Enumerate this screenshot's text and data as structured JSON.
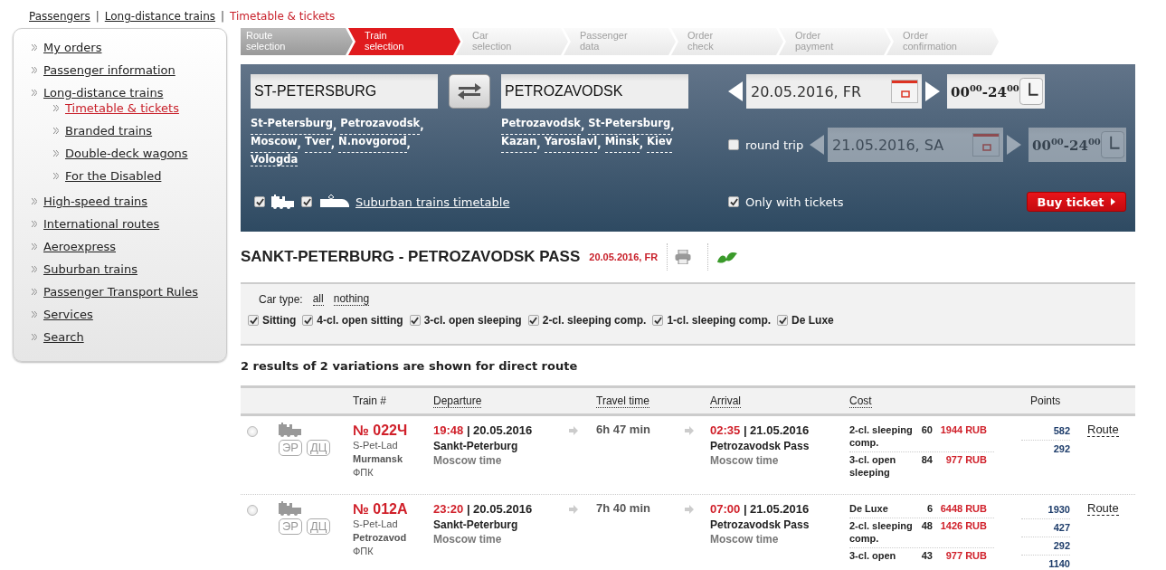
{
  "breadcrumb_separator": "|",
  "suggestion_separator": ",",
  "breadcrumbs": [
    {
      "label": "Passengers",
      "selected": false
    },
    {
      "label": "Long-distance trains",
      "selected": false
    },
    {
      "label": "Timetable & tickets",
      "selected": true
    }
  ],
  "sidebar": {
    "items": [
      {
        "label": "My orders",
        "selected": false
      },
      {
        "label": "Passenger information",
        "selected": false
      },
      {
        "label": "Long-distance trains",
        "selected": false,
        "children": [
          {
            "label": "Timetable & tickets",
            "selected": true
          },
          {
            "label": "Branded trains",
            "selected": false
          },
          {
            "label": "Double-deck wagons",
            "selected": false
          },
          {
            "label": "For the Disabled",
            "selected": false
          }
        ]
      },
      {
        "label": "High-speed trains",
        "selected": false
      },
      {
        "label": "International routes",
        "selected": false
      },
      {
        "label": "Aeroexpress",
        "selected": false
      },
      {
        "label": "Suburban trains",
        "selected": false
      },
      {
        "label": "Passenger Transport Rules",
        "selected": false
      },
      {
        "label": "Services",
        "selected": false
      },
      {
        "label": "Search",
        "selected": false
      }
    ]
  },
  "steps": [
    {
      "label": "Route selection",
      "selected": false,
      "completed": true
    },
    {
      "label": "Train selection",
      "selected": true,
      "completed": false
    },
    {
      "label": "Car selection",
      "selected": false,
      "completed": false
    },
    {
      "label": "Passenger data",
      "selected": false,
      "completed": false
    },
    {
      "label": "Order check",
      "selected": false,
      "completed": false
    },
    {
      "label": "Order payment",
      "selected": false,
      "completed": false
    },
    {
      "label": "Order confirmation",
      "selected": false,
      "completed": false
    }
  ],
  "search": {
    "from": {
      "value": "ST-PETERSBURG",
      "suggestions": [
        "St-Petersburg",
        "Petrozavodsk",
        "Moscow",
        "Tver",
        "N.novgorod",
        "Vologda"
      ]
    },
    "to": {
      "value": "PETROZAVODSK",
      "suggestions": [
        "Petrozavodsk",
        "St-Petersburg",
        "Kazan",
        "Yaroslavl",
        "Minsk",
        "Kiev"
      ]
    },
    "depart": {
      "date": "20.05.2016, FR",
      "time": "00$^{00}$-24$^{00}$"
    },
    "round_trip": {
      "label": "round trip",
      "checked": false,
      "date": "21.05.2016, SA",
      "time": "00$^{00}$-24$^{00}$"
    },
    "train_types": [
      {
        "kind": "long",
        "checked": true
      },
      {
        "kind": "suburban",
        "checked": true
      }
    ],
    "suburban_link": "Suburban trains timetable",
    "only_with_tickets": {
      "label": "Only with tickets",
      "checked": true
    },
    "buy_button": "Buy ticket"
  },
  "result": {
    "title": "SANKT-PETERBURG - PETROZAVODSK PASS",
    "date": "20.05.2016, FR",
    "car_type": {
      "label": "Car type:",
      "links": [
        "all",
        "nothing"
      ]
    },
    "car_filters": [
      {
        "label": "Sitting",
        "checked": true
      },
      {
        "label": "4-cl. open sitting",
        "checked": true
      },
      {
        "label": "3-cl. open sleeping",
        "checked": true
      },
      {
        "label": "2-cl. sleeping comp.",
        "checked": true
      },
      {
        "label": "1-cl. sleeping comp.",
        "checked": true
      },
      {
        "label": "De Luxe",
        "checked": true
      }
    ],
    "summary": "2 results of 2 variations are shown for direct route"
  },
  "table": {
    "columns": [
      "Train #",
      "Departure",
      "Travel time",
      "Arrival",
      "Cost",
      "Points"
    ],
    "rows": [
      {
        "selected": false,
        "badges": [
          "ЭР",
          "ДЦ"
        ],
        "train_no": "№ 022Ч",
        "route_lines": [
          "S-Pet-Lad",
          "Murmansk",
          "ФПК"
        ],
        "dep_time": "19:48",
        "dep_date": "| 20.05.2016",
        "dep_station": "Sankt-Peterburg",
        "dep_zone": "Moscow time",
        "travel": "6h 47 min",
        "arr_time": "02:35",
        "arr_date": "| 21.05.2016",
        "arr_station": "Petrozavodsk Pass",
        "arr_zone": "Moscow time",
        "costs": [
          {
            "class": "2-cl. sleeping comp.",
            "seats": "60",
            "price": "1944 RUB"
          },
          {
            "class": "3-cl. open sleeping",
            "seats": "84",
            "price": "977 RUB"
          }
        ],
        "points": [
          "582",
          "292"
        ],
        "route_link": "Route"
      },
      {
        "selected": false,
        "badges": [
          "ЭР",
          "ДЦ"
        ],
        "train_no": "№ 012A",
        "route_lines": [
          "S-Pet-Lad",
          "Petrozavod",
          "ФПК"
        ],
        "dep_time": "23:20",
        "dep_date": "| 20.05.2016",
        "dep_station": "Sankt-Peterburg",
        "dep_zone": "Moscow time",
        "travel": "7h 40 min",
        "arr_time": "07:00",
        "arr_date": "| 21.05.2016",
        "arr_station": "Petrozavodsk Pass",
        "arr_zone": "Moscow time",
        "costs": [
          {
            "class": "De Luxe",
            "seats": "6",
            "price": "6448 RUB"
          },
          {
            "class": "2-cl. sleeping comp.",
            "seats": "48",
            "price": "1426 RUB"
          },
          {
            "class": "3-cl. open",
            "seats": "43",
            "price": "977 RUB"
          }
        ],
        "points": [
          "1930",
          "427",
          "292",
          "1140"
        ],
        "route_link": "Route"
      }
    ]
  }
}
